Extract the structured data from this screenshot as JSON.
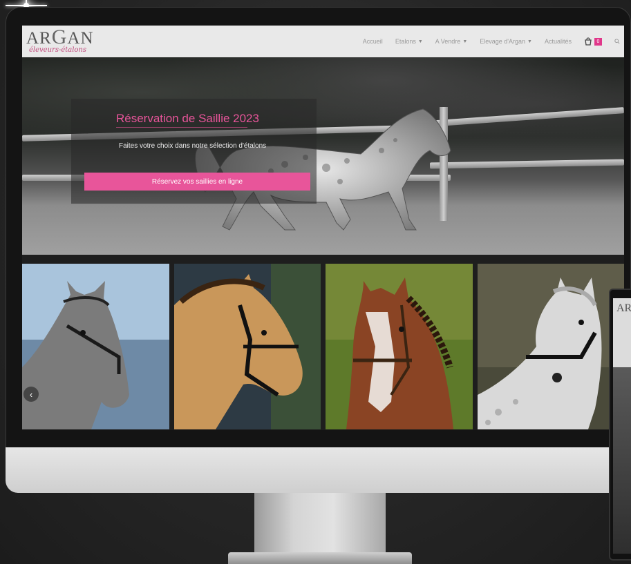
{
  "brand": {
    "name_prefix": "AR",
    "name_big": "G",
    "name_suffix": "AN",
    "tagline": "éleveurs-étalons"
  },
  "nav": {
    "items": [
      {
        "label": "Accueil",
        "has_dropdown": false
      },
      {
        "label": "Etalons",
        "has_dropdown": true
      },
      {
        "label": "A Vendre",
        "has_dropdown": true
      },
      {
        "label": "Elevage d'Argan",
        "has_dropdown": true
      },
      {
        "label": "Actualités",
        "has_dropdown": false
      }
    ],
    "cart_count": "0",
    "cart_icon": "bag-icon",
    "search_icon": "search-icon"
  },
  "hero": {
    "title": "Réservation de Saillie 2023",
    "subtitle": "Faites votre choix dans notre sélection d'étalons",
    "button_label": "Réservez vos saillies en ligne"
  },
  "gallery": {
    "prev_label": "‹",
    "tiles": [
      {
        "alt": "Grey pony on beach",
        "color": "#6f6f6f"
      },
      {
        "alt": "Palomino pony with bridle",
        "color": "#c89a5e"
      },
      {
        "alt": "Bay pony with braided mane",
        "color": "#7a3f22"
      },
      {
        "alt": "Dappled grey pony",
        "color": "#c9c9c9"
      }
    ]
  },
  "side_device": {
    "logo": "AR"
  },
  "colors": {
    "accent": "#e8559a",
    "navbar_bg": "#e9e9e9",
    "badge": "#e0378a"
  }
}
